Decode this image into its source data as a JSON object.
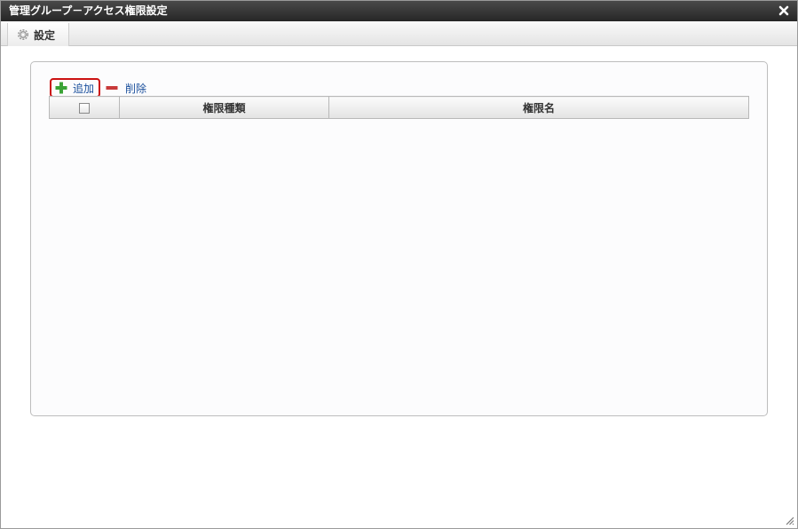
{
  "window": {
    "title": "管理グループ－アクセス権限設定",
    "close_icon": "close-icon"
  },
  "toolbar": {
    "tab_label": "設定",
    "tab_icon": "gear-icon"
  },
  "actions": {
    "add_label": "追加",
    "add_icon": "plus-icon",
    "delete_label": "削除",
    "delete_icon": "minus-icon"
  },
  "grid": {
    "columns": [
      "権限種類",
      "権限名"
    ],
    "rows": []
  },
  "colors": {
    "titlebar": "#333333",
    "link": "#1a4f9c",
    "highlight": "#cc1111",
    "add_icon": "#3aa336",
    "delete_icon": "#c83a3a"
  }
}
